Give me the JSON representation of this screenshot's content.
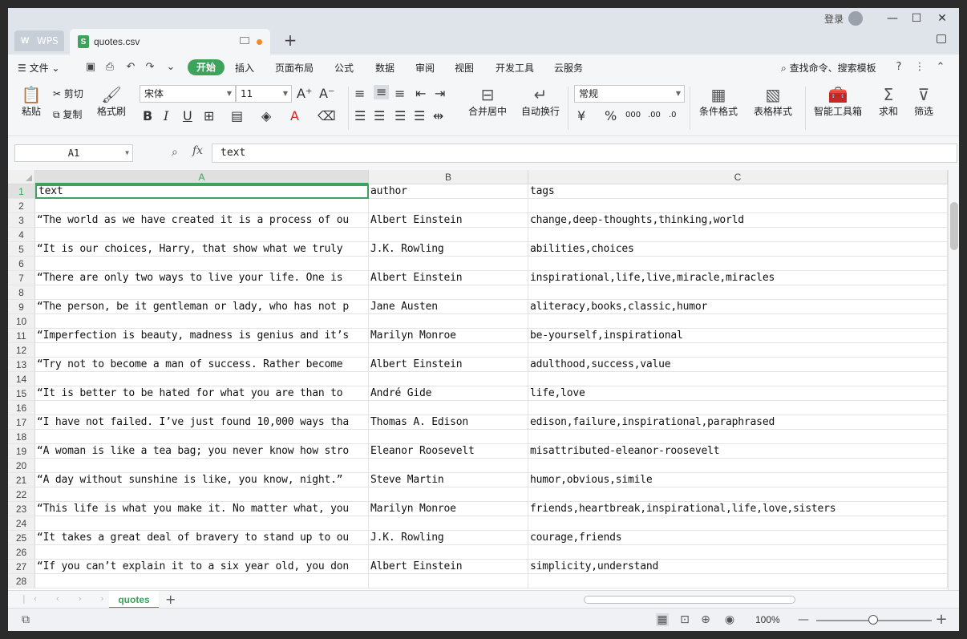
{
  "titlebar": {
    "app_tab": "WPS",
    "file_tab": "quotes.csv",
    "login": "登录"
  },
  "menubar": {
    "file": "文件",
    "active_tab": "开始",
    "tabs": [
      "插入",
      "页面布局",
      "公式",
      "数据",
      "审阅",
      "视图",
      "开发工具",
      "云服务"
    ],
    "search": "查找命令、搜索模板"
  },
  "ribbon": {
    "paste": "粘贴",
    "cut": "剪切",
    "copy": "复制",
    "format_painter": "格式刷",
    "font_name": "宋体",
    "font_size": "11",
    "merge_center": "合并居中",
    "wrap_text": "自动换行",
    "number_format": "常规",
    "conditional_format": "条件格式",
    "table_style": "表格样式",
    "smart_toolbox": "智能工具箱",
    "sum": "求和",
    "filter": "筛选"
  },
  "formulabar": {
    "cell_ref": "A1",
    "fx": "fx",
    "content": "text"
  },
  "columns": [
    "A",
    "B",
    "C"
  ],
  "rows": [
    {
      "n": "1",
      "a": "text",
      "b": "author",
      "c": "tags"
    },
    {
      "n": "2",
      "a": "",
      "b": "",
      "c": ""
    },
    {
      "n": "3",
      "a": "“The world as we have created it is a process of ou",
      "b": "Albert Einstein",
      "c": "change,deep-thoughts,thinking,world"
    },
    {
      "n": "4",
      "a": "",
      "b": "",
      "c": ""
    },
    {
      "n": "5",
      "a": "“It is our choices, Harry, that show what we truly",
      "b": "J.K. Rowling",
      "c": "abilities,choices"
    },
    {
      "n": "6",
      "a": "",
      "b": "",
      "c": ""
    },
    {
      "n": "7",
      "a": "“There are only two ways to live your life. One is",
      "b": "Albert Einstein",
      "c": "inspirational,life,live,miracle,miracles"
    },
    {
      "n": "8",
      "a": "",
      "b": "",
      "c": ""
    },
    {
      "n": "9",
      "a": "“The person, be it gentleman or lady, who has not p",
      "b": "Jane Austen",
      "c": "aliteracy,books,classic,humor"
    },
    {
      "n": "10",
      "a": "",
      "b": "",
      "c": ""
    },
    {
      "n": "11",
      "a": "“Imperfection is beauty, madness is genius and it’s",
      "b": "Marilyn Monroe",
      "c": "be-yourself,inspirational"
    },
    {
      "n": "12",
      "a": "",
      "b": "",
      "c": ""
    },
    {
      "n": "13",
      "a": "“Try not to become a man of success. Rather become",
      "b": "Albert Einstein",
      "c": "adulthood,success,value"
    },
    {
      "n": "14",
      "a": "",
      "b": "",
      "c": ""
    },
    {
      "n": "15",
      "a": "“It is better to be hated for what you are than to",
      "b": "André Gide",
      "c": "life,love"
    },
    {
      "n": "16",
      "a": "",
      "b": "",
      "c": ""
    },
    {
      "n": "17",
      "a": "“I have not failed. I’ve just found 10,000 ways tha",
      "b": "Thomas A. Edison",
      "c": "edison,failure,inspirational,paraphrased"
    },
    {
      "n": "18",
      "a": "",
      "b": "",
      "c": ""
    },
    {
      "n": "19",
      "a": "“A woman is like a tea bag; you never know how stro",
      "b": "Eleanor Roosevelt",
      "c": "misattributed-eleanor-roosevelt"
    },
    {
      "n": "20",
      "a": "",
      "b": "",
      "c": ""
    },
    {
      "n": "21",
      "a": "“A day without sunshine is like, you know, night.”",
      "b": "Steve Martin",
      "c": "humor,obvious,simile"
    },
    {
      "n": "22",
      "a": "",
      "b": "",
      "c": ""
    },
    {
      "n": "23",
      "a": "“This life is what you make it. No matter what, you",
      "b": "Marilyn Monroe",
      "c": "friends,heartbreak,inspirational,life,love,sisters"
    },
    {
      "n": "24",
      "a": "",
      "b": "",
      "c": ""
    },
    {
      "n": "25",
      "a": "“It takes a great deal of bravery to stand up to ou",
      "b": "J.K. Rowling",
      "c": "courage,friends"
    },
    {
      "n": "26",
      "a": "",
      "b": "",
      "c": ""
    },
    {
      "n": "27",
      "a": "“If you can’t explain it to a six year old, you don",
      "b": "Albert Einstein",
      "c": "simplicity,understand"
    },
    {
      "n": "28",
      "a": "",
      "b": "",
      "c": ""
    }
  ],
  "sheetbar": {
    "sheet_name": "quotes"
  },
  "statusbar": {
    "zoom": "100%"
  }
}
